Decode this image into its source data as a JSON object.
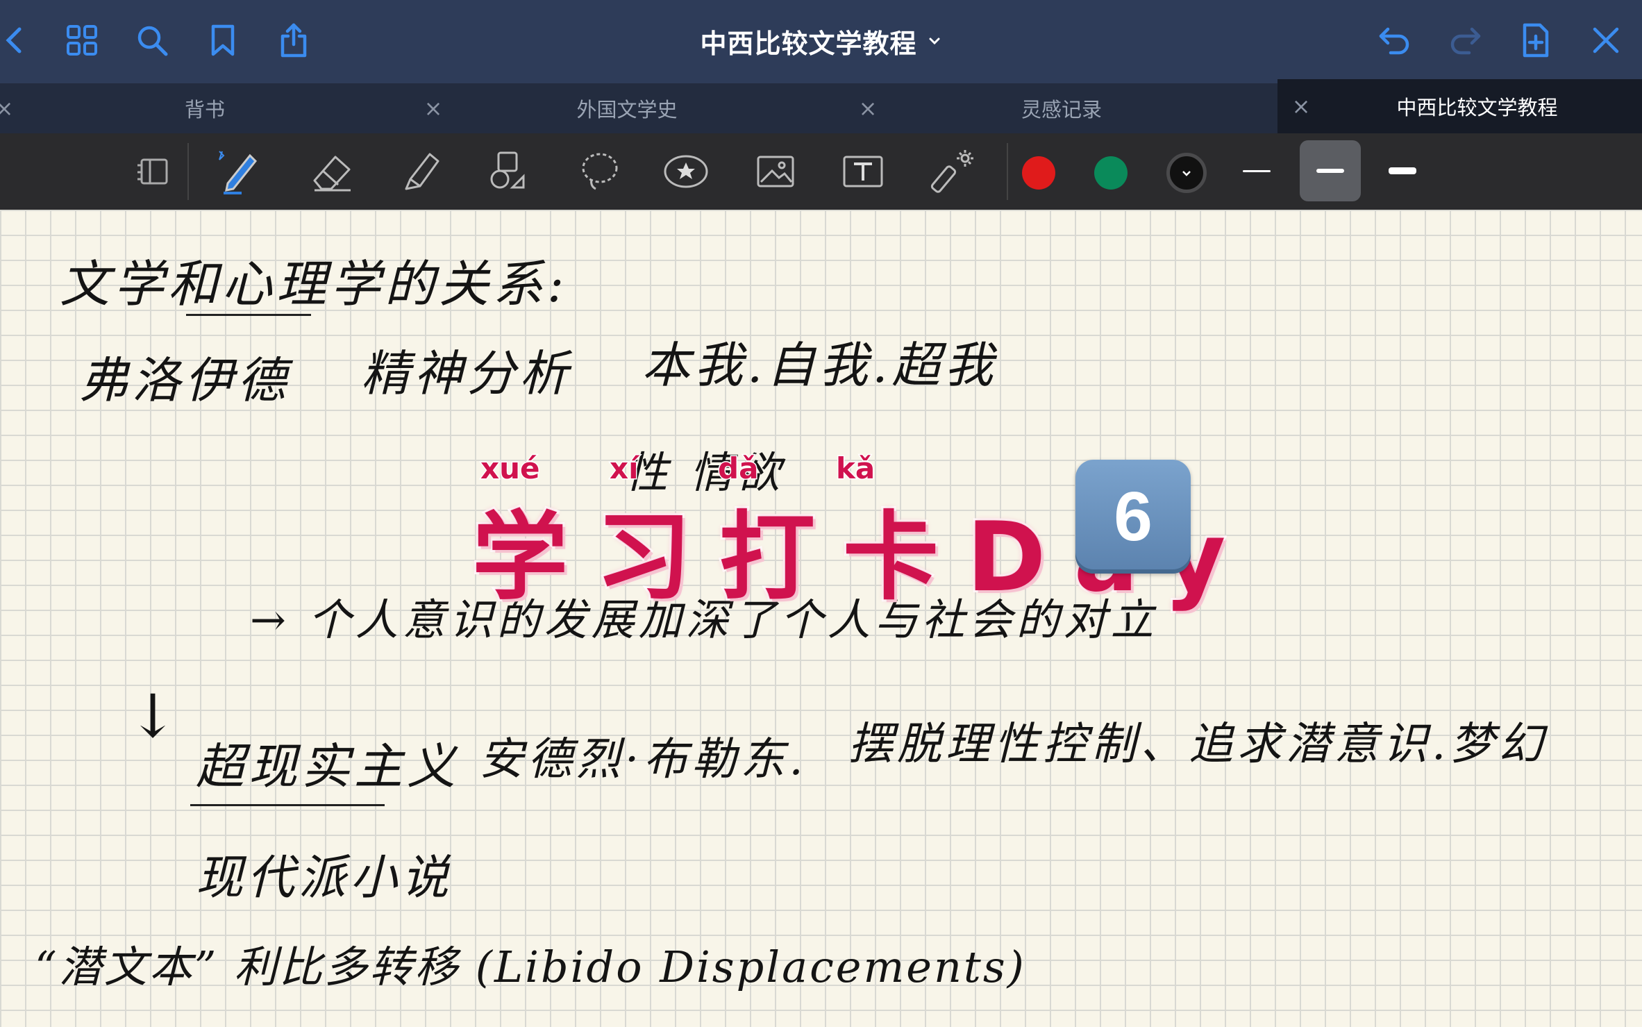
{
  "app": {
    "document_title": "中西比较文学教程"
  },
  "tabs": [
    {
      "label": "背书"
    },
    {
      "label": "外国文学史"
    },
    {
      "label": "灵感记录"
    },
    {
      "label": "中西比较文学教程",
      "active": true
    }
  ],
  "tab_close_glyph": "×",
  "toolbar": {
    "tools": [
      "reader-mode-icon",
      "pen-icon",
      "eraser-icon",
      "highlighter-icon",
      "shapes-icon",
      "lasso-icon",
      "sticker-icon",
      "image-icon",
      "text-box-icon",
      "laser-pointer-icon"
    ],
    "colors": [
      "#e01b1b",
      "#0a8a5a",
      "#111111"
    ],
    "stroke_widths": [
      "thin",
      "medium",
      "thick"
    ],
    "selected_stroke": "medium",
    "selected_tool": "pen-icon"
  },
  "note": {
    "lines": [
      "文学和心理学的关系:",
      "弗洛伊德",
      "精神分析",
      "本我.自我.超我",
      "性 情欲",
      "→ 个人意识的发展加深了个人与社会的对立",
      "↓",
      "超现实主义",
      "安德烈·布勒东.",
      "摆脱理性控制、追求潜意识.梦幻",
      "现代派小说",
      "“潜文本” 利比多转移 (Libido Displacements)"
    ]
  },
  "banner": {
    "text": "学习打卡Day",
    "pinyin": [
      "xué",
      "xí",
      "dǎ",
      "kǎ"
    ],
    "day_number": "6",
    "color": "#d0124e"
  }
}
